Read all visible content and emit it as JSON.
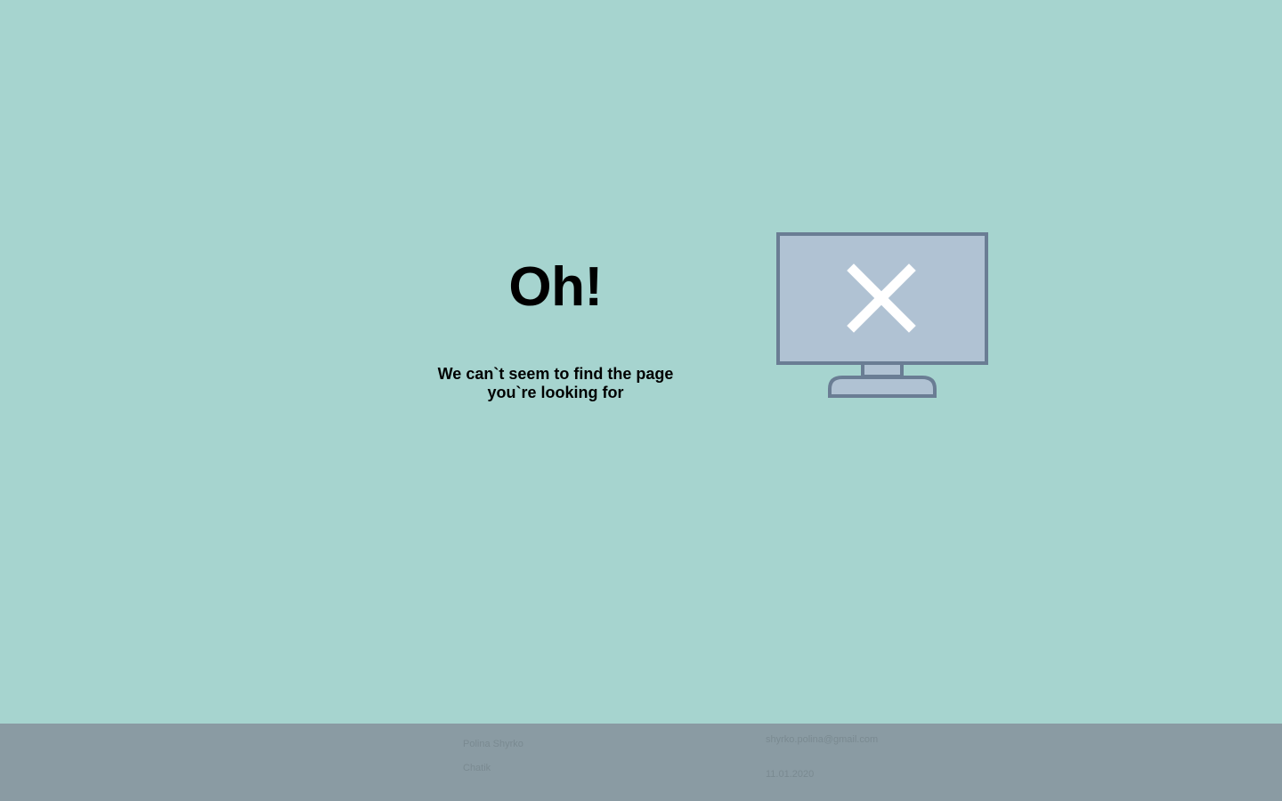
{
  "error": {
    "title": "Oh!",
    "message": "We can`t seem to find the page you`re looking for",
    "illustration_icon": "monitor-error-icon"
  },
  "footer": {
    "author": "Polina Shyrko",
    "app_name": "Chatik",
    "email": "shyrko.polina@gmail.com",
    "date": "11.01.2020"
  },
  "colors": {
    "background": "#a6d4cf",
    "footer_background": "#8a9ba3",
    "footer_text": "#7a8a91",
    "monitor_screen": "#b0c2d3",
    "monitor_frame": "#6a7d94"
  }
}
